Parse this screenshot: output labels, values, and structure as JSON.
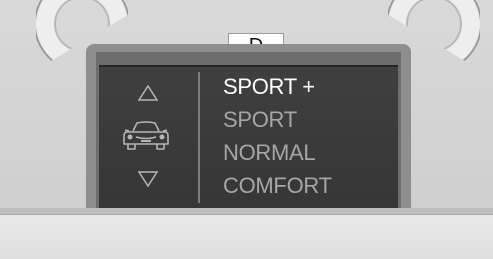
{
  "gear_indicator": "D",
  "mode_menu": {
    "items": [
      {
        "label": "SPORT +",
        "selected": true
      },
      {
        "label": "SPORT",
        "selected": false
      },
      {
        "label": "NORMAL",
        "selected": false
      },
      {
        "label": "COMFORT",
        "selected": false
      }
    ],
    "icons": {
      "up": "triangle-up-icon",
      "down": "triangle-down-icon",
      "vehicle": "car-front-icon"
    }
  },
  "colors": {
    "panel_background": "#3a3a3a",
    "selected_text": "#ffffff",
    "unselected_text": "#a6a6a6",
    "gear_box_background": "#ffffff",
    "gear_text": "#111111"
  }
}
